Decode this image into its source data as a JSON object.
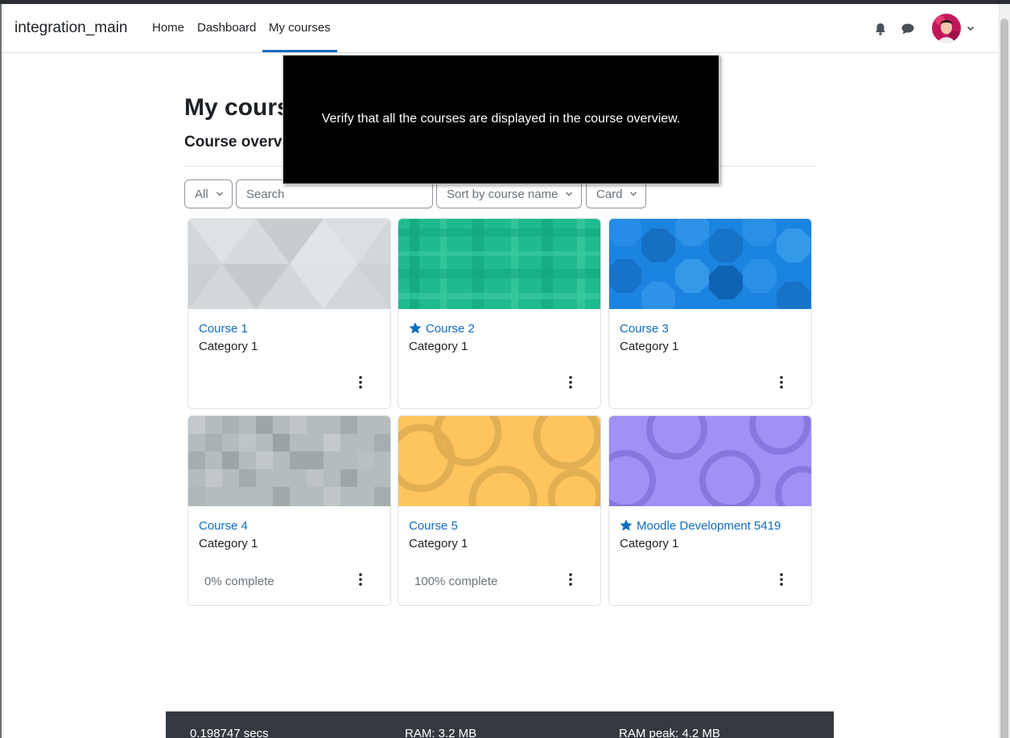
{
  "navbar": {
    "brand": "integration_main",
    "links": [
      "Home",
      "Dashboard",
      "My courses"
    ],
    "active": "My courses",
    "icons": [
      "bell-icon",
      "chat-icon",
      "chevron-down-icon"
    ]
  },
  "page": {
    "title": "My cours",
    "section_title": "Course overv"
  },
  "controls": {
    "grouping": "All",
    "search_placeholder": "Search",
    "sort": "Sort by course name",
    "view": "Card"
  },
  "courses": [
    {
      "name": "Course 1",
      "category": "Category 1",
      "starred": false,
      "progress": ""
    },
    {
      "name": "Course 2",
      "category": "Category 1",
      "starred": true,
      "progress": ""
    },
    {
      "name": "Course 3",
      "category": "Category 1",
      "starred": false,
      "progress": ""
    },
    {
      "name": "Course 4",
      "category": "Category 1",
      "starred": false,
      "progress": "0% complete"
    },
    {
      "name": "Course 5",
      "category": "Category 1",
      "starred": false,
      "progress": "100% complete"
    },
    {
      "name": "Moodle Development 5419",
      "category": "Category 1",
      "starred": true,
      "progress": ""
    }
  ],
  "tour": {
    "message": "Verify that all the courses are displayed in the course overview."
  },
  "footer": {
    "time": "0.198747 secs",
    "ram": "RAM: 3.2 MB",
    "ram_peak": "RAM peak: 4.2 MB"
  },
  "colors": {
    "link": "#0f6cbf",
    "footer_bg": "#343a40",
    "overlay_bg": "#000000"
  }
}
